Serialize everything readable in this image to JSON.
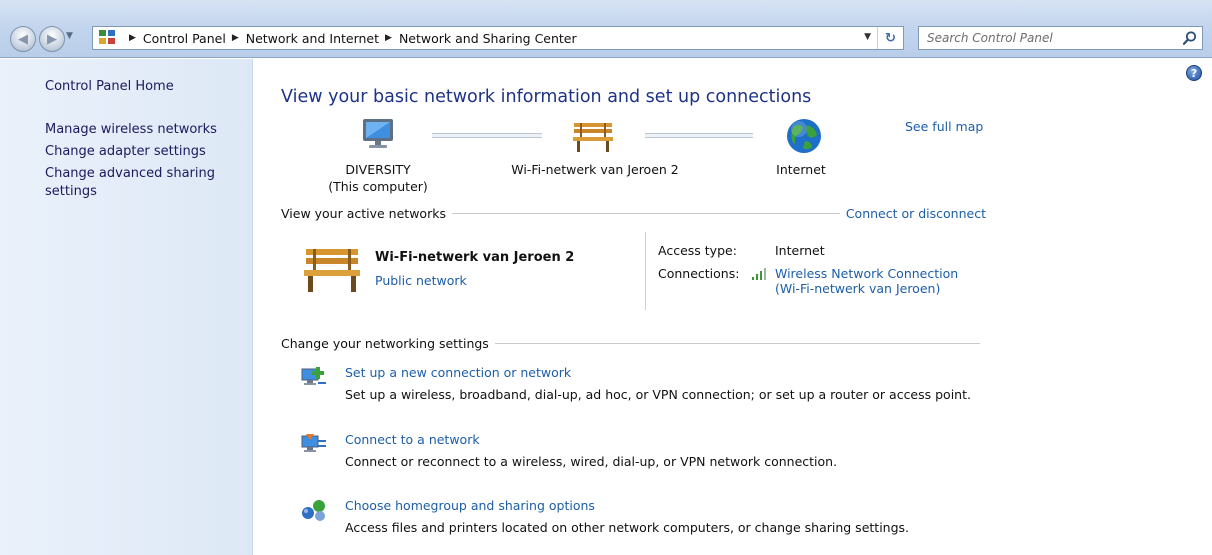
{
  "address_bar": {
    "breadcrumbs": [
      "Control Panel",
      "Network and Internet",
      "Network and Sharing Center"
    ],
    "search_placeholder": "Search Control Panel"
  },
  "sidebar": {
    "home": "Control Panel Home",
    "links": [
      "Manage wireless networks",
      "Change adapter settings",
      "Change advanced sharing settings"
    ]
  },
  "main": {
    "title": "View your basic network information and set up connections",
    "see_full_map": "See full map",
    "map": {
      "computer_name": "DIVERSITY",
      "computer_sub": "(This computer)",
      "network": "Wi-Fi-netwerk van Jeroen  2",
      "internet": "Internet"
    },
    "active_networks": {
      "header": "View your active networks",
      "connect_link": "Connect or disconnect",
      "network_name": "Wi-Fi-netwerk van Jeroen  2",
      "network_type": "Public network",
      "access_type_label": "Access type:",
      "access_type_value": "Internet",
      "connections_label": "Connections:",
      "connection_line1": "Wireless Network Connection",
      "connection_line2": "(Wi-Fi-netwerk van Jeroen)"
    },
    "settings": {
      "header": "Change your networking settings",
      "tasks": [
        {
          "link": "Set up a new connection or network",
          "desc": "Set up a wireless, broadband, dial-up, ad hoc, or VPN connection; or set up a router or access point."
        },
        {
          "link": "Connect to a network",
          "desc": "Connect or reconnect to a wireless, wired, dial-up, or VPN network connection."
        },
        {
          "link": "Choose homegroup and sharing options",
          "desc": "Access files and printers located on other network computers, or change sharing settings."
        }
      ]
    }
  },
  "colors": {
    "link": "#1c5ea9",
    "title": "#1e3287",
    "sidebar_text": "#1a1a5c"
  }
}
